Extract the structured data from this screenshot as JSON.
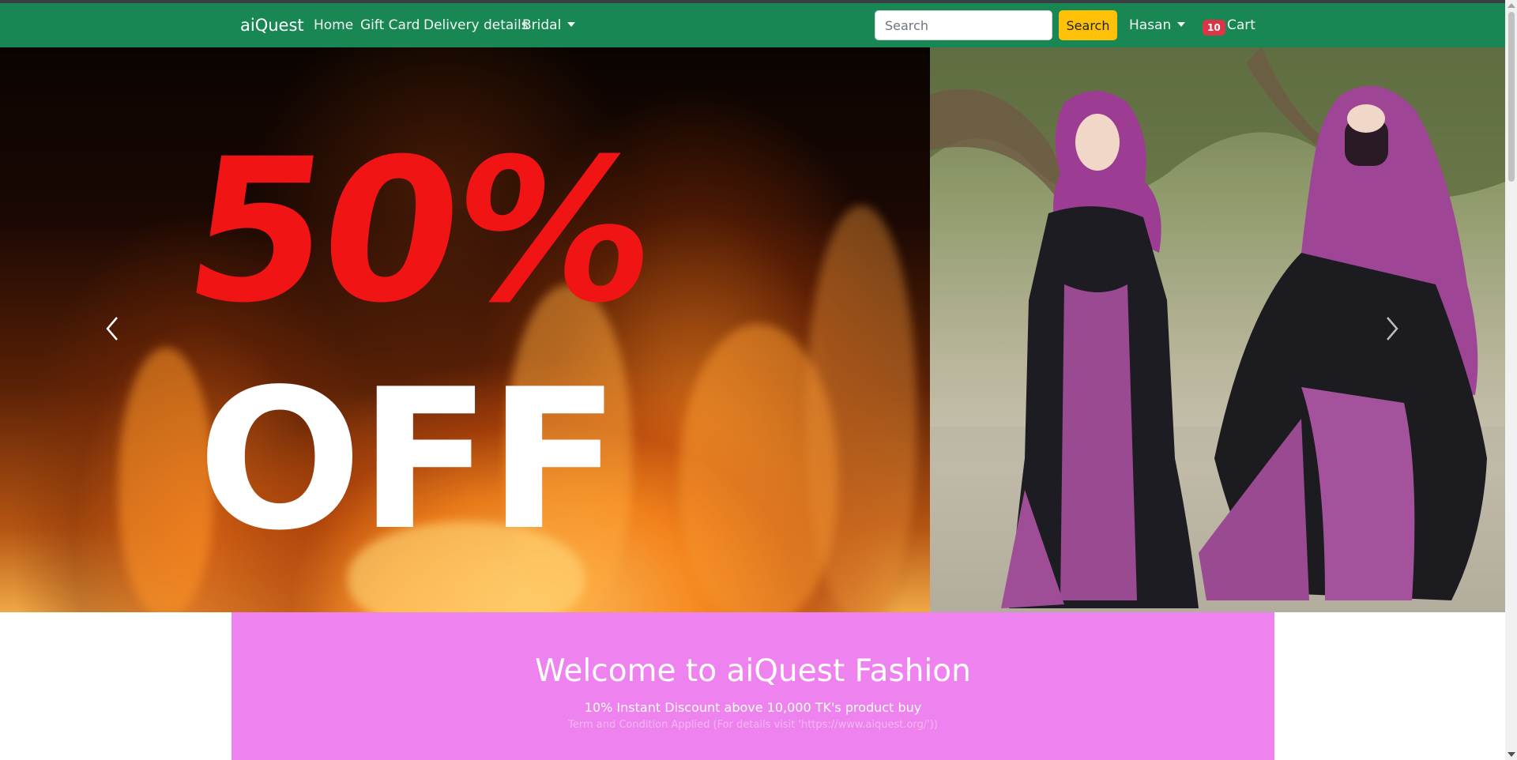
{
  "navbar": {
    "brand": "aiQuest",
    "links": [
      "Home",
      "Gift Card",
      "Delivery details"
    ],
    "dropdown": "Bridal",
    "search": {
      "placeholder": "Search",
      "button": "Search"
    },
    "user": "Hasan",
    "cart": {
      "count": "10",
      "label": "Cart"
    },
    "accent": "#198754"
  },
  "carousel": {
    "promo_top": "50%",
    "promo_bottom": "OFF",
    "prev_icon": "chevron-left-icon",
    "next_icon": "chevron-right-icon"
  },
  "welcome": {
    "title": "Welcome to aiQuest Fashion",
    "subtitle": "10% Instant Discount above 10,000 TK's product buy",
    "note": "Term and Condition Applied (For details visit 'https://www.aiquest.org/'))",
    "background": "#ee82ee"
  }
}
